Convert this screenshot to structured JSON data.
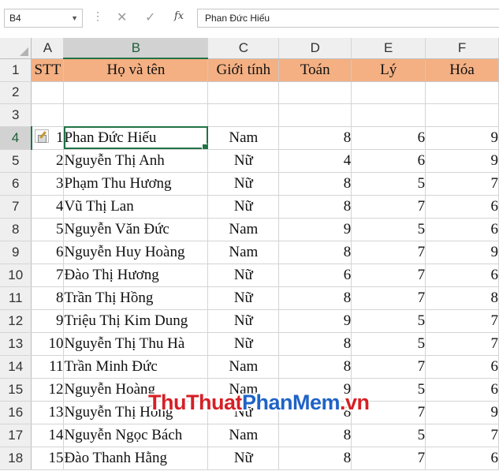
{
  "formula_bar": {
    "name_box": "B4",
    "fx_label": "fx",
    "cancel_glyph": "✕",
    "enter_glyph": "✓",
    "formula_value": "Phan Đức Hiếu"
  },
  "columns": [
    "A",
    "B",
    "C",
    "D",
    "E",
    "F"
  ],
  "selected_column": "B",
  "row_numbers": [
    "1",
    "2",
    "3",
    "4",
    "5",
    "6",
    "7",
    "8",
    "9",
    "10",
    "11",
    "12",
    "13",
    "14",
    "15",
    "16",
    "17",
    "18"
  ],
  "selected_row": "4",
  "header_fill_color": "#f4b083",
  "headers": [
    "STT",
    "Họ và tên",
    "Giới tính",
    "Toán",
    "Lý",
    "Hóa"
  ],
  "students": [
    {
      "stt": "1",
      "name": "Phan Đức Hiếu",
      "gender": "Nam",
      "toan": "8",
      "ly": "6",
      "hoa": "9"
    },
    {
      "stt": "2",
      "name": "Nguyễn Thị Anh",
      "gender": "Nữ",
      "toan": "4",
      "ly": "6",
      "hoa": "9"
    },
    {
      "stt": "3",
      "name": "Phạm Thu Hương",
      "gender": "Nữ",
      "toan": "8",
      "ly": "5",
      "hoa": "7"
    },
    {
      "stt": "4",
      "name": "Vũ Thị Lan",
      "gender": "Nữ",
      "toan": "8",
      "ly": "7",
      "hoa": "6"
    },
    {
      "stt": "5",
      "name": "Nguyễn Văn Đức",
      "gender": "Nam",
      "toan": "9",
      "ly": "5",
      "hoa": "6"
    },
    {
      "stt": "6",
      "name": "Nguyễn Huy Hoàng",
      "gender": "Nam",
      "toan": "8",
      "ly": "7",
      "hoa": "9"
    },
    {
      "stt": "7",
      "name": "Đào Thị Hương",
      "gender": "Nữ",
      "toan": "6",
      "ly": "7",
      "hoa": "6"
    },
    {
      "stt": "8",
      "name": "Trần Thị Hồng",
      "gender": "Nữ",
      "toan": "8",
      "ly": "7",
      "hoa": "8"
    },
    {
      "stt": "9",
      "name": "Triệu Thị Kim Dung",
      "gender": "Nữ",
      "toan": "9",
      "ly": "5",
      "hoa": "7"
    },
    {
      "stt": "10",
      "name": "Nguyễn Thị Thu Hà",
      "gender": "Nữ",
      "toan": "8",
      "ly": "5",
      "hoa": "7"
    },
    {
      "stt": "11",
      "name": "Trần Minh Đức",
      "gender": "Nam",
      "toan": "8",
      "ly": "7",
      "hoa": "6"
    },
    {
      "stt": "12",
      "name": "Nguyễn Hoàng",
      "gender": "Nam",
      "toan": "9",
      "ly": "5",
      "hoa": "6"
    },
    {
      "stt": "13",
      "name": "Nguyễn Thị Hồng",
      "gender": "Nữ",
      "toan": "8",
      "ly": "7",
      "hoa": "9"
    },
    {
      "stt": "14",
      "name": "Nguyễn Ngọc Bách",
      "gender": "Nam",
      "toan": "8",
      "ly": "5",
      "hoa": "7"
    },
    {
      "stt": "15",
      "name": "Đào Thanh Hằng",
      "gender": "Nữ",
      "toan": "8",
      "ly": "7",
      "hoa": "6"
    }
  ],
  "watermark": {
    "part1": "ThuThuat",
    "part2": "PhanMem",
    "part3": ".vn"
  }
}
